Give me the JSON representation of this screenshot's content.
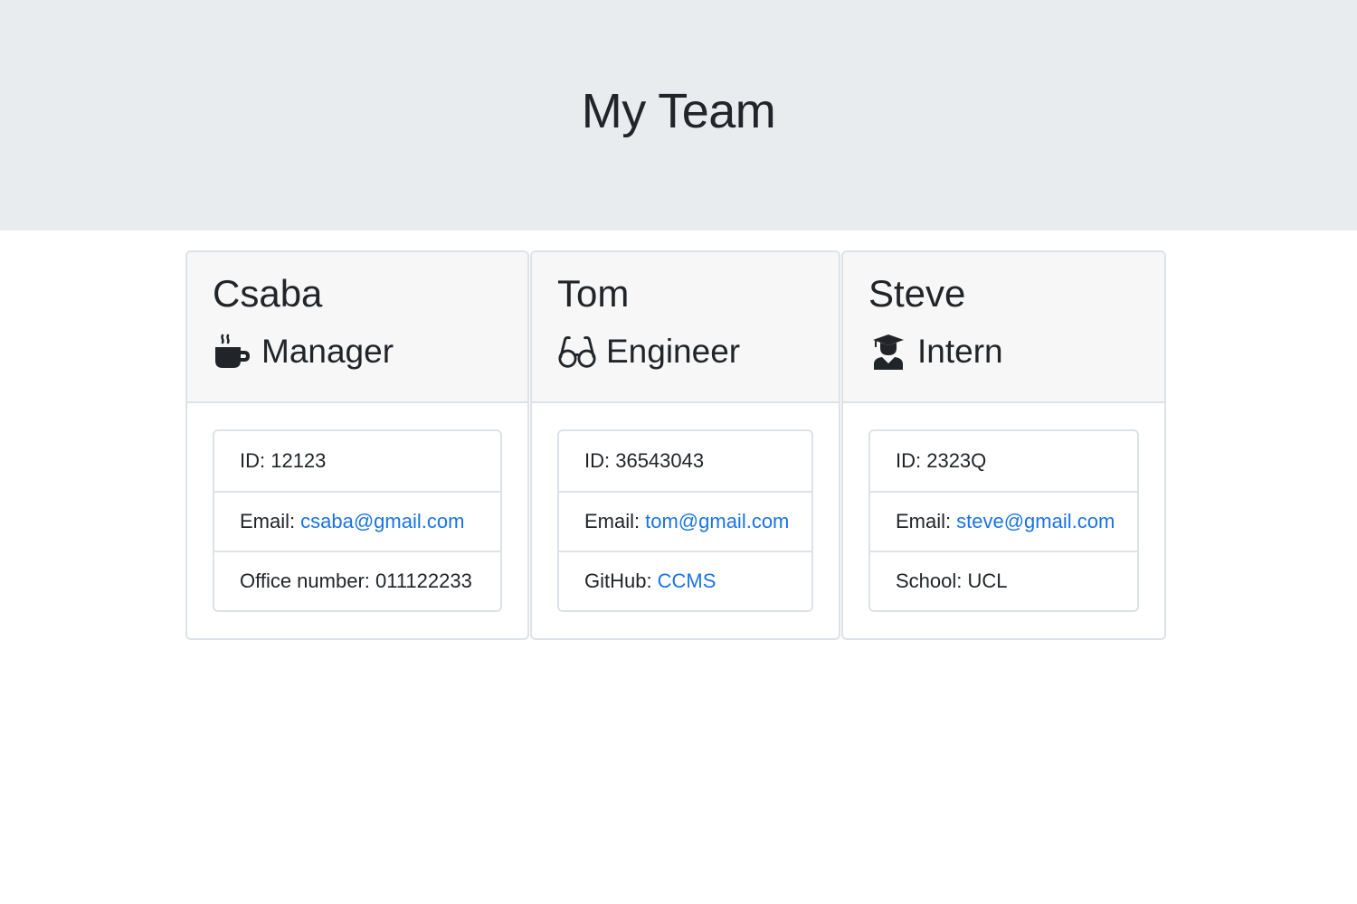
{
  "page": {
    "title": "My Team"
  },
  "colors": {
    "header_bg": "#e9ecef",
    "card_header_bg": "#f7f7f7",
    "link": "#1a73e8",
    "text": "#212529"
  },
  "team": [
    {
      "name": "Csaba",
      "role": "Manager",
      "icon": "mug-icon",
      "id_label": "ID: 12123",
      "email_label": "Email:",
      "email": "csaba@gmail.com",
      "extra_label": "Office number: 011122233"
    },
    {
      "name": "Tom",
      "role": "Engineer",
      "icon": "glasses-icon",
      "id_label": "ID: 36543043",
      "email_label": "Email:",
      "email": "tom@gmail.com",
      "extra_label": "GitHub:",
      "extra_link": "CCMS"
    },
    {
      "name": "Steve",
      "role": "Intern",
      "icon": "graduate-icon",
      "id_label": "ID: 2323Q",
      "email_label": "Email:",
      "email": "steve@gmail.com",
      "extra_label": "School: UCL"
    }
  ]
}
